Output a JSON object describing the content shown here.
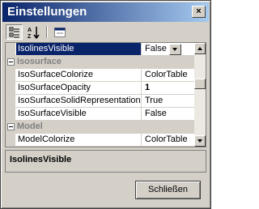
{
  "window": {
    "title": "Einstellungen",
    "close_glyph": "×"
  },
  "toolbar": {
    "buttons": [
      {
        "icon": "categorized-icon"
      },
      {
        "icon": "alphabetical-icon"
      },
      {
        "icon": "property-pages-icon"
      }
    ]
  },
  "grid": {
    "rows": [
      {
        "type": "property",
        "name": "IsolinesVisible",
        "value": "False",
        "selected": true
      },
      {
        "type": "category",
        "name": "Isosurface"
      },
      {
        "type": "property",
        "name": "IsoSurfaceColorize",
        "value": "ColorTable"
      },
      {
        "type": "property",
        "name": "IsoSurfaceOpacity",
        "value": "1",
        "bold_value": true
      },
      {
        "type": "property",
        "name": "IsoSurfaceSolidRepresentation",
        "value": "True"
      },
      {
        "type": "property",
        "name": "IsoSurfaceVisible",
        "value": "False"
      },
      {
        "type": "category",
        "name": "Model"
      },
      {
        "type": "property",
        "name": "ModelColorize",
        "value": "ColorTable"
      }
    ]
  },
  "description": {
    "title": "IsolinesVisible"
  },
  "footer": {
    "close_label": "Schließen"
  }
}
